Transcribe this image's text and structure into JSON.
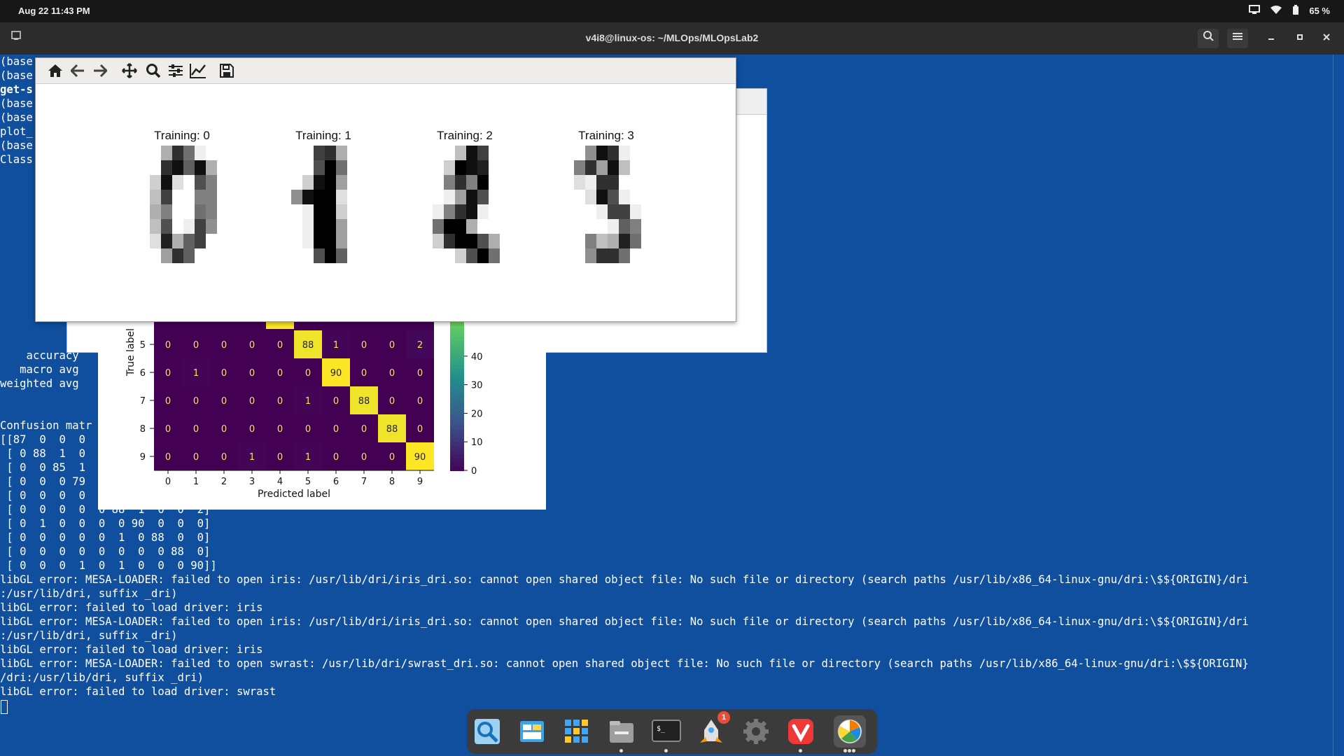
{
  "topbar": {
    "clock": "Aug 22  11:43 PM",
    "battery": "65 %"
  },
  "window": {
    "title": "v4i8@linux-os: ~/MLOps/MLOpsLab2"
  },
  "terminal": {
    "left_snippets": [
      "(base",
      "(base",
      "get-s",
      "(base",
      "(base",
      "plot_",
      "(base",
      "Class"
    ],
    "report_rows": [
      "    accuracy",
      "   macro avg",
      "weighted avg"
    ],
    "confusion_header": "Confusion matr",
    "matrix_lines_left": [
      "[[87  0  0  0",
      " [ 0 88  1  0",
      " [ 0  0 85  1",
      " [ 0  0  0 79",
      " [ 0  0  0  0"
    ],
    "matrix_lines_full": [
      " [ 0  0  0  0  0 88  1  0  0  2]",
      " [ 0  1  0  0  0  0 90  0  0  0]",
      " [ 0  0  0  0  0  1  0 88  0  0]",
      " [ 0  0  0  0  0  0  0  0 88  0]",
      " [ 0  0  0  1  0  1  0  0  0 90]]"
    ],
    "error_lines": [
      "libGL error: MESA-LOADER: failed to open iris: /usr/lib/dri/iris_dri.so: cannot open shared object file: No such file or directory (search paths /usr/lib/x86_64-linux-gnu/dri:\\$${ORIGIN}/dri",
      ":/usr/lib/dri, suffix _dri)",
      "libGL error: failed to load driver: iris",
      "libGL error: MESA-LOADER: failed to open iris: /usr/lib/dri/iris_dri.so: cannot open shared object file: No such file or directory (search paths /usr/lib/x86_64-linux-gnu/dri:\\$${ORIGIN}/dri",
      ":/usr/lib/dri, suffix _dri)",
      "libGL error: failed to load driver: iris",
      "libGL error: MESA-LOADER: failed to open swrast: /usr/lib/dri/swrast_dri.so: cannot open shared object file: No such file or directory (search paths /usr/lib/x86_64-linux-gnu/dri:\\$${ORIGIN}",
      "/dri:/usr/lib/dri, suffix _dri)",
      "libGL error: failed to load driver: swrast"
    ]
  },
  "digits_window": {
    "titles": [
      "Training: 0",
      "Training: 1",
      "Training: 2",
      "Training: 3"
    ],
    "images": [
      [
        [
          0,
          0,
          5,
          13,
          9,
          1,
          0,
          0
        ],
        [
          0,
          0,
          13,
          15,
          10,
          15,
          5,
          0
        ],
        [
          0,
          3,
          15,
          2,
          0,
          11,
          8,
          0
        ],
        [
          0,
          4,
          12,
          0,
          0,
          8,
          8,
          0
        ],
        [
          0,
          5,
          8,
          0,
          0,
          9,
          8,
          0
        ],
        [
          0,
          4,
          11,
          0,
          1,
          12,
          7,
          0
        ],
        [
          0,
          2,
          14,
          5,
          10,
          12,
          0,
          0
        ],
        [
          0,
          0,
          6,
          13,
          10,
          0,
          0,
          0
        ]
      ],
      [
        [
          0,
          0,
          0,
          12,
          13,
          5,
          0,
          0
        ],
        [
          0,
          0,
          0,
          11,
          16,
          9,
          0,
          0
        ],
        [
          0,
          0,
          3,
          15,
          16,
          6,
          0,
          0
        ],
        [
          0,
          7,
          15,
          16,
          16,
          2,
          0,
          0
        ],
        [
          0,
          0,
          1,
          16,
          16,
          3,
          0,
          0
        ],
        [
          0,
          0,
          1,
          16,
          16,
          6,
          0,
          0
        ],
        [
          0,
          0,
          1,
          16,
          16,
          6,
          0,
          0
        ],
        [
          0,
          0,
          0,
          11,
          16,
          10,
          0,
          0
        ]
      ],
      [
        [
          0,
          0,
          0,
          4,
          15,
          12,
          0,
          0
        ],
        [
          0,
          0,
          3,
          16,
          15,
          14,
          0,
          0
        ],
        [
          0,
          0,
          8,
          13,
          8,
          16,
          0,
          0
        ],
        [
          0,
          0,
          1,
          6,
          15,
          11,
          0,
          0
        ],
        [
          0,
          1,
          8,
          13,
          15,
          1,
          0,
          0
        ],
        [
          0,
          9,
          16,
          16,
          5,
          0,
          0,
          0
        ],
        [
          0,
          3,
          13,
          16,
          16,
          11,
          5,
          0
        ],
        [
          0,
          0,
          0,
          3,
          11,
          16,
          9,
          0
        ]
      ],
      [
        [
          0,
          0,
          7,
          15,
          13,
          1,
          0,
          0
        ],
        [
          0,
          8,
          13,
          6,
          15,
          4,
          0,
          0
        ],
        [
          0,
          2,
          1,
          13,
          13,
          0,
          0,
          0
        ],
        [
          0,
          0,
          2,
          15,
          11,
          1,
          0,
          0
        ],
        [
          0,
          0,
          0,
          1,
          12,
          12,
          1,
          0
        ],
        [
          0,
          0,
          0,
          0,
          1,
          10,
          8,
          0
        ],
        [
          0,
          0,
          8,
          4,
          5,
          14,
          9,
          0
        ],
        [
          0,
          0,
          7,
          13,
          13,
          9,
          0,
          0
        ]
      ]
    ]
  },
  "confusion_plot": {
    "ylabel": "True label",
    "xlabel": "Predicted label",
    "x_ticks": [
      "0",
      "1",
      "2",
      "3",
      "4",
      "5",
      "6",
      "7",
      "8",
      "9"
    ],
    "rows": [
      {
        "label": "5",
        "values": [
          0,
          0,
          0,
          0,
          0,
          88,
          1,
          0,
          0,
          2
        ]
      },
      {
        "label": "6",
        "values": [
          0,
          1,
          0,
          0,
          0,
          0,
          90,
          0,
          0,
          0
        ]
      },
      {
        "label": "7",
        "values": [
          0,
          0,
          0,
          0,
          0,
          1,
          0,
          88,
          0,
          0
        ]
      },
      {
        "label": "8",
        "values": [
          0,
          0,
          0,
          0,
          0,
          0,
          0,
          0,
          88,
          0
        ]
      },
      {
        "label": "9",
        "values": [
          0,
          0,
          0,
          1,
          0,
          1,
          0,
          0,
          0,
          90
        ]
      }
    ],
    "colorbar_ticks": [
      "40",
      "30",
      "20",
      "10",
      "0"
    ],
    "vmax": 90
  },
  "dock": {
    "badge": "1"
  }
}
